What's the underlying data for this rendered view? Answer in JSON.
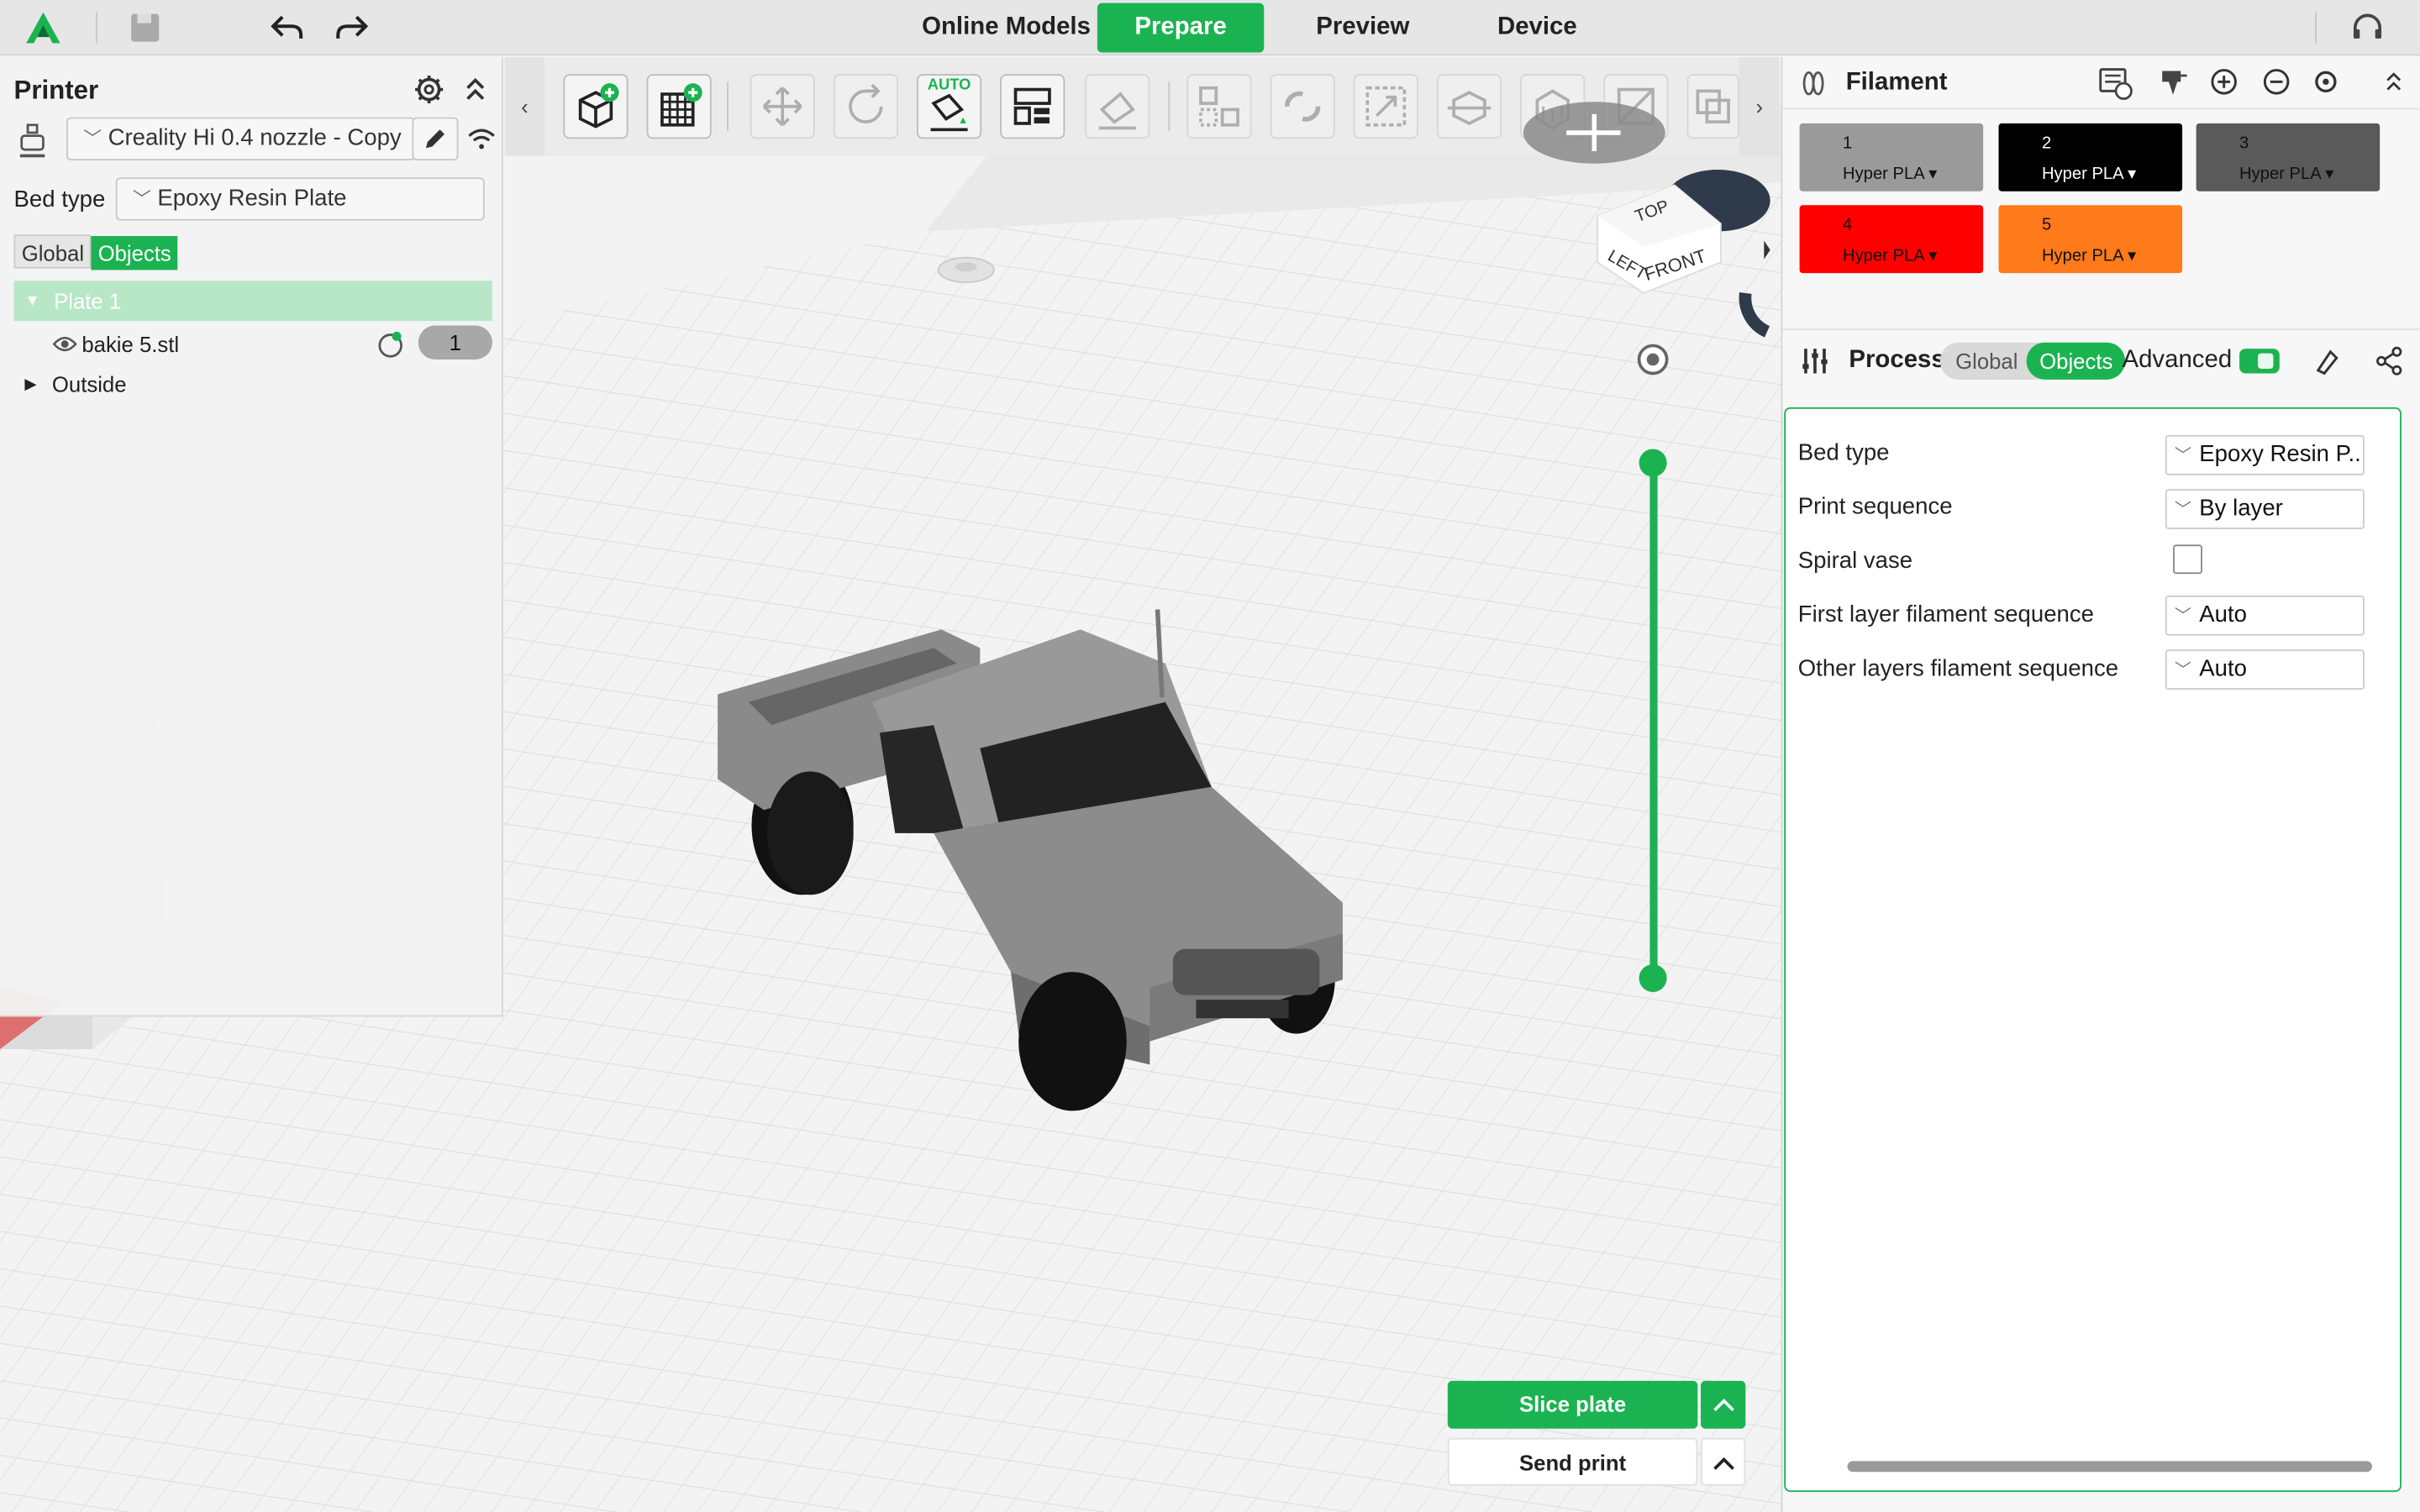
{
  "topbar": {
    "tabs": [
      "Online Models",
      "Prepare",
      "Preview",
      "Device"
    ],
    "active_tab": "Prepare",
    "icons": [
      "app-logo-icon",
      "save-icon",
      "undo-icon",
      "redo-icon",
      "support-headset-icon"
    ]
  },
  "printer_panel": {
    "title": "Printer",
    "printer_name": "Creality Hi 0.4 nozzle - Copy",
    "bed_type_label": "Bed type",
    "bed_type_value": "Epoxy Resin Plate",
    "mode_global": "Global",
    "mode_objects": "Objects",
    "tree": {
      "plate": "Plate 1",
      "object": "bakie 5.stl",
      "object_filament": "1",
      "outside": "Outside"
    }
  },
  "toolbar": {
    "auto_label": "AUTO",
    "icons": [
      "add-object-icon",
      "add-plate-icon",
      "move-icon",
      "rotate-icon",
      "auto-orient-icon",
      "arrange-icon",
      "lay-on-face-icon",
      "split-objects-icon",
      "split-parts-icon",
      "scale-icon",
      "cut-icon",
      "support-paint-icon",
      "seam-paint-icon",
      "more-icon"
    ]
  },
  "viewport": {
    "view_cube": {
      "top": "TOP",
      "left": "LEFT",
      "front": "FRONT"
    },
    "slice_button": "Slice plate",
    "send_button": "Send print"
  },
  "filament_panel": {
    "title": "Filament",
    "filaments": [
      {
        "num": "1",
        "material": "Hyper PLA",
        "color": "#9a9a9a",
        "text_color": "#111111"
      },
      {
        "num": "2",
        "material": "Hyper PLA",
        "color": "#000000",
        "text_color": "#ffffff"
      },
      {
        "num": "3",
        "material": "Hyper PLA",
        "color": "#5a5a5a",
        "text_color": "#111111"
      },
      {
        "num": "4",
        "material": "Hyper PLA",
        "color": "#ff0000",
        "text_color": "#111111"
      },
      {
        "num": "5",
        "material": "Hyper PLA",
        "color": "#ff7a1a",
        "text_color": "#111111"
      }
    ]
  },
  "process_panel": {
    "title": "Process",
    "mode_global": "Global",
    "mode_objects": "Objects",
    "advanced_label": "Advanced",
    "advanced_on": true,
    "rows": [
      {
        "label": "Bed type",
        "value": "Epoxy Resin P..."
      },
      {
        "label": "Print sequence",
        "value": "By layer"
      },
      {
        "label": "Spiral vase",
        "checked": false
      },
      {
        "label": "First layer filament sequence",
        "value": "Auto"
      },
      {
        "label": "Other layers filament sequence",
        "value": "Auto"
      }
    ]
  },
  "colors": {
    "accent": "#1bb351",
    "toolbar_bg": "#ebebeb",
    "panel_bg": "#f7f7f7"
  }
}
